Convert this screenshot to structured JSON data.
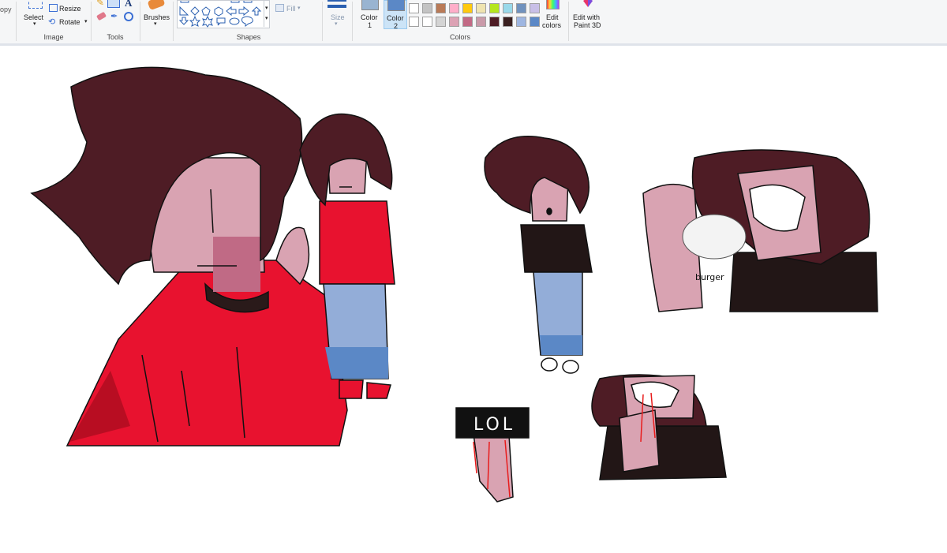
{
  "ribbon": {
    "clipboard": {
      "copy_label": "opy"
    },
    "image": {
      "select_label": "Select",
      "resize_label": "Resize",
      "rotate_label": "Rotate",
      "group_label": "Image"
    },
    "tools": {
      "group_label": "Tools",
      "text_tool_glyph": "A"
    },
    "brushes": {
      "label": "Brushes"
    },
    "shapes": {
      "fill_label": "Fill",
      "group_label": "Shapes"
    },
    "size": {
      "label": "Size"
    },
    "colors": {
      "color1_label": "Color",
      "color1_num": "1",
      "color2_label": "Color",
      "color2_num": "2",
      "edit_colors_line1": "Edit",
      "edit_colors_line2": "colors",
      "group_label": "Colors",
      "color1_value": "#99b4d1",
      "color2_value": "#5b88c6",
      "palette_row1": [
        "#ffffff",
        "#c3c3c3",
        "#b97a57",
        "#ffaec9",
        "#ffc90e",
        "#efe4b0",
        "#b5e61d",
        "#99d9ea",
        "#7092be",
        "#c8bfe7"
      ],
      "palette_row2": [
        "#ffffff",
        "#ffffff",
        "#d4d4d4",
        "#dca2b4",
        "#c26a85",
        "#c99aa9",
        "#4e1c25",
        "#3a2020",
        "#9eb6e1",
        "#5b88c6"
      ]
    },
    "paint3d": {
      "line1": "Edit with",
      "line2": "Paint 3D"
    }
  },
  "canvas": {
    "annotations": {
      "burger_label": "burger",
      "sign_text": "LOL"
    }
  }
}
